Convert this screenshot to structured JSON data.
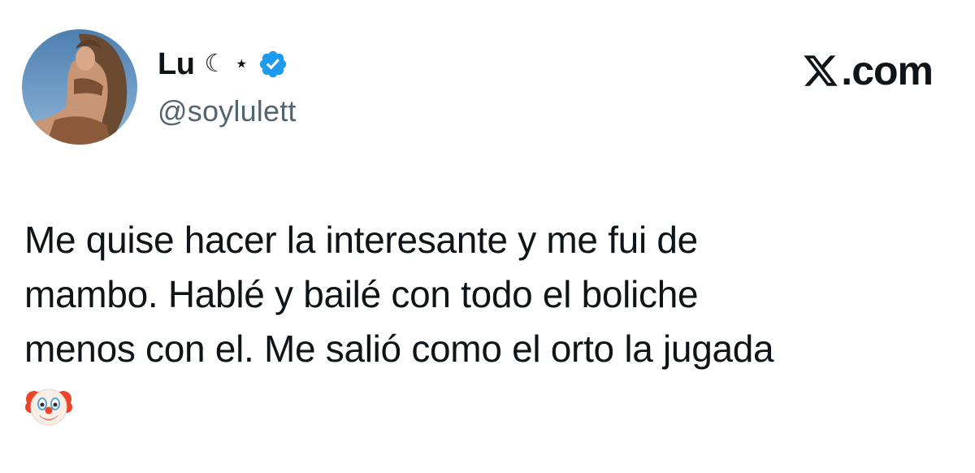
{
  "author": {
    "display_name": "Lu",
    "name_emoji": "☾ ⋆",
    "handle": "@soylulett",
    "verified_icon": "verified-badge-icon",
    "avatar_icon": "profile-photo"
  },
  "brand": {
    "logo_icon": "x-logo-icon",
    "domain": ".com"
  },
  "tweet": {
    "lines": [
      "Me quise hacer la interesante y me fui de",
      "mambo. Hablé y bailé con todo el boliche",
      "menos con el. Me salió como el orto la jugada"
    ],
    "emoji_icon": "clown-face-icon"
  },
  "colors": {
    "verified": "#1d9bf0",
    "handle": "#536471",
    "text": "#0f1419"
  }
}
